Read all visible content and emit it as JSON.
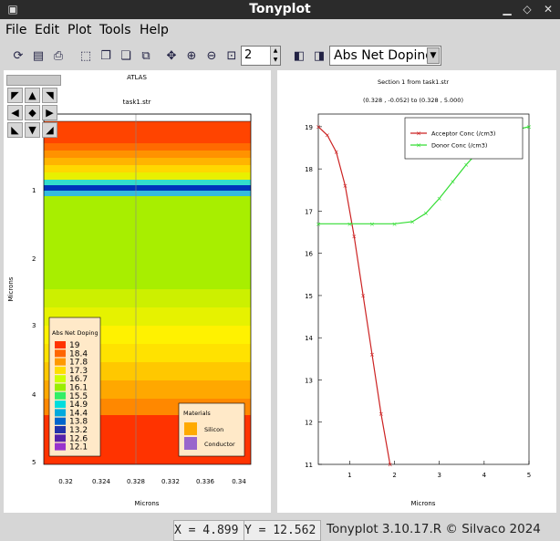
{
  "window": {
    "title": "Tonyplot"
  },
  "menu": [
    "File",
    "Edit",
    "Plot",
    "Tools",
    "Help"
  ],
  "toolbar": {
    "zoom_level": "2",
    "quantity": "Abs Net Doping"
  },
  "left_plot": {
    "header1": "ATLAS",
    "header2": "task1.str",
    "ylabel": "Microns",
    "xlabel": "Microns",
    "yticks": [
      "1",
      "2",
      "3",
      "4",
      "5"
    ],
    "xticks": [
      "0.32",
      "0.324",
      "0.328",
      "0.332",
      "0.336",
      "0.34"
    ],
    "legend": {
      "title": "Abs Net Doping",
      "levels": [
        "19",
        "18.4",
        "17.8",
        "17.3",
        "16.7",
        "16.1",
        "15.5",
        "14.9",
        "14.4",
        "13.8",
        "13.2",
        "12.6",
        "12.1"
      ],
      "colors": [
        "#ff3300",
        "#ff6600",
        "#ff9900",
        "#ffdd00",
        "#ccff00",
        "#99ee00",
        "#33ee66",
        "#00dddd",
        "#00aadd",
        "#0066cc",
        "#2233aa",
        "#5522aa",
        "#9933cc"
      ]
    },
    "materials": {
      "title": "Materials",
      "items": [
        {
          "name": "Silicon",
          "color": "#ffaa00"
        },
        {
          "name": "Conductor",
          "color": "#9966cc"
        }
      ]
    }
  },
  "right_plot": {
    "title": "Section 1 from task1.str",
    "subtitle": "(0.328 , -0.052) to (0.328 , 5.000)",
    "xlabel": "Microns"
  },
  "chart_data": {
    "type": "line",
    "title": "Section 1 from task1.str",
    "xlabel": "Microns",
    "ylabel": "",
    "xlim": [
      0.3,
      5.0
    ],
    "ylim": [
      11,
      19.3
    ],
    "xticks": [
      "1",
      "2",
      "3",
      "4",
      "5"
    ],
    "yticks": [
      "11",
      "12",
      "13",
      "14",
      "15",
      "16",
      "17",
      "18",
      "19"
    ],
    "legend_position": "top-right",
    "series": [
      {
        "name": "Acceptor Conc (/cm3)",
        "color": "#cc2222",
        "x": [
          0.3,
          0.5,
          0.7,
          0.9,
          1.1,
          1.3,
          1.5,
          1.7,
          1.9
        ],
        "y": [
          19.0,
          18.8,
          18.4,
          17.6,
          16.4,
          15.0,
          13.6,
          12.2,
          11.0
        ]
      },
      {
        "name": "Donor Conc (/cm3)",
        "color": "#33dd33",
        "x": [
          0.3,
          1.0,
          1.5,
          2.0,
          2.4,
          2.7,
          3.0,
          3.3,
          3.6,
          3.9,
          4.2,
          4.5,
          4.8,
          5.0
        ],
        "y": [
          16.7,
          16.7,
          16.7,
          16.7,
          16.75,
          16.95,
          17.3,
          17.7,
          18.1,
          18.45,
          18.7,
          18.85,
          18.95,
          19.0
        ]
      }
    ]
  },
  "statusbar": {
    "x_readout": "X = 4.899",
    "y_readout": "Y = 12.562",
    "version": "Tonyplot 3.10.17.R © Silvaco 2024"
  }
}
